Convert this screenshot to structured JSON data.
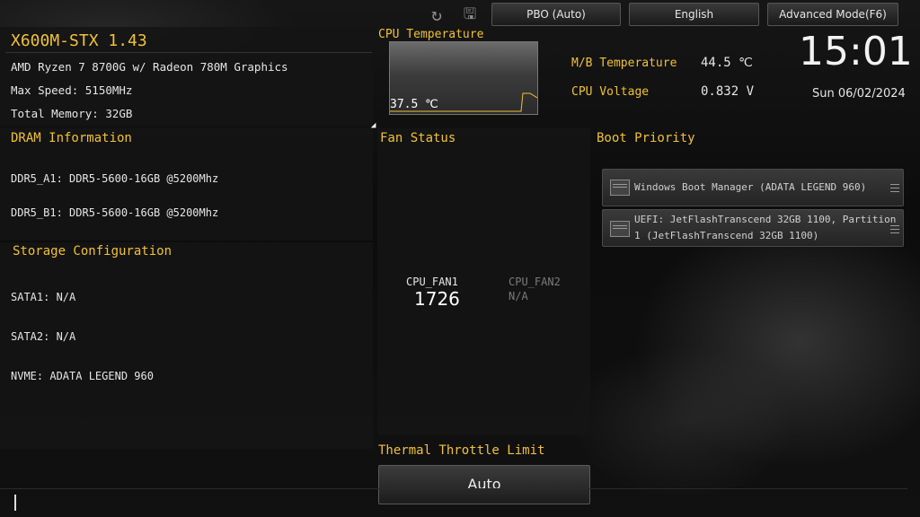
{
  "topbar": {
    "refresh_icon": "refresh-icon",
    "save_icon": "save-icon",
    "pbo_label": "PBO (Auto)",
    "language_label": "English",
    "advanced_label": "Advanced Mode(F6)"
  },
  "system": {
    "model": "X600M-STX 1.43",
    "cpu": "AMD Ryzen 7 8700G w/ Radeon 780M Graphics",
    "max_speed": "Max Speed: 5150MHz",
    "total_memory": "Total Memory: 32GB"
  },
  "cpu_temp": {
    "title": "CPU Temperature",
    "value": "37.5 ℃"
  },
  "monitor": {
    "mb_temp_label": "M/B Temperature",
    "mb_temp_value": "44.5 ℃",
    "cpu_voltage_label": "CPU Voltage",
    "cpu_voltage_value": "0.832 V"
  },
  "clock": {
    "time": "15:01",
    "date": "Sun 06/02/2024"
  },
  "dram": {
    "title": "DRAM Information",
    "slots": [
      "DDR5_A1: DDR5-5600-16GB @5200Mhz",
      "DDR5_B1: DDR5-5600-16GB @5200Mhz"
    ]
  },
  "storage": {
    "title": "Storage Configuration",
    "items": [
      "SATA1: N/A",
      "SATA2: N/A",
      "NVME: ADATA LEGEND 960"
    ]
  },
  "fan": {
    "title": "Fan Status",
    "fan1_label": "CPU_FAN1",
    "fan1_value": "1726",
    "fan2_label": "CPU_FAN2",
    "fan2_value": "N/A"
  },
  "thermal": {
    "title": "Thermal Throttle Limit",
    "value": "Auto"
  },
  "boot": {
    "title": "Boot Priority",
    "items": [
      "Windows Boot Manager (ADATA LEGEND 960)",
      "UEFI: JetFlashTranscend 32GB 1100, Partition\n 1 (JetFlashTranscend 32GB 1100)"
    ]
  },
  "colors": {
    "accent": "#f1c232",
    "panel": "#141414"
  }
}
